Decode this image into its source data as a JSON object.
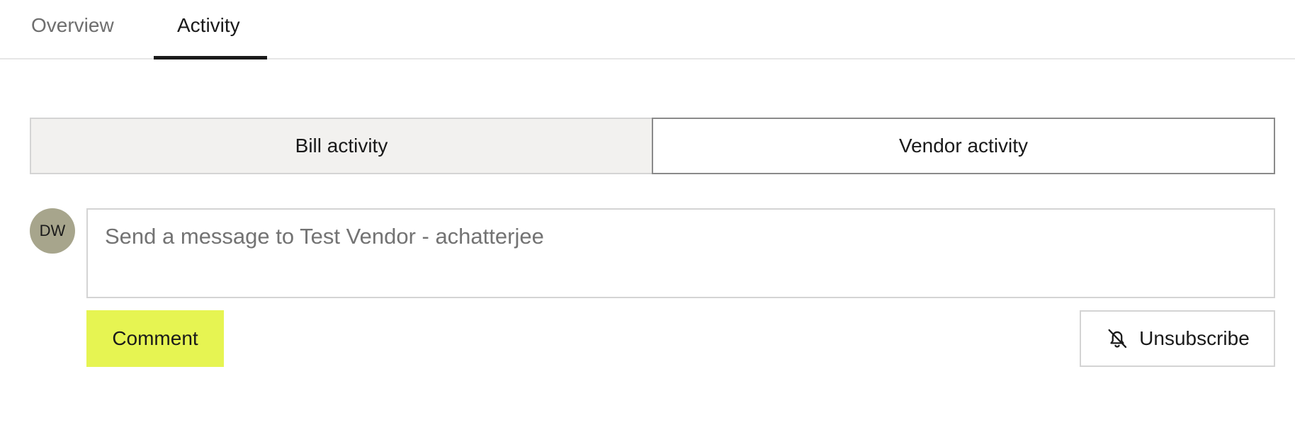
{
  "tabs": {
    "overview_label": "Overview",
    "activity_label": "Activity",
    "active": "Activity"
  },
  "segmented": {
    "bill_label": "Bill activity",
    "vendor_label": "Vendor activity",
    "selected": "Vendor activity"
  },
  "avatar": {
    "initials": "DW",
    "color": "#a7a58c"
  },
  "message": {
    "placeholder": "Send a message to Test Vendor - achatterjee",
    "value": ""
  },
  "actions": {
    "comment_label": "Comment",
    "comment_color": "#e6f452",
    "unsubscribe_label": "Unsubscribe",
    "unsubscribe_icon": "bell-off-icon"
  }
}
